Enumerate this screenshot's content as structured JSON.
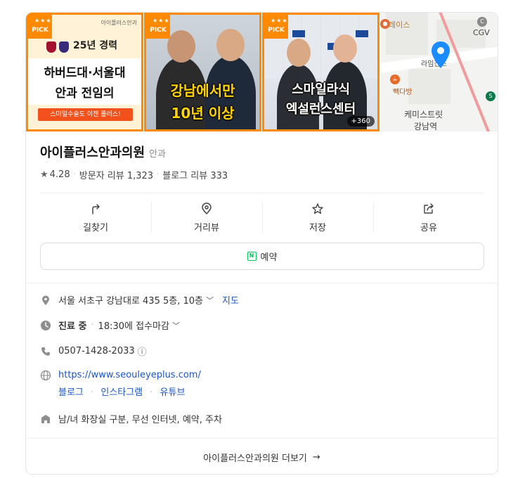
{
  "photos": {
    "pick_label": "PICK",
    "photo1": {
      "logo_text": "아이플러스안과",
      "years": "25년 경력",
      "line1": "하버드대·서울대",
      "line2": "안과 전임의",
      "tagline": "스마일수술도 이젠 플러스!"
    },
    "photo2": {
      "line1": "강남에서만",
      "line2": "10년 이상"
    },
    "photo3": {
      "line1": "스마일라식",
      "line2": "엑설런스센터",
      "more_count": "+360"
    },
    "map": {
      "labels": {
        "top": "레이스",
        "cgv": "CGV",
        "mid": "라임진즈",
        "cafe": "빽다방",
        "station1": "케미스트릿",
        "station2": "강남역"
      }
    }
  },
  "place": {
    "name": "아이플러스안과의원",
    "category": "안과",
    "rating": "4.28",
    "visitor_reviews": "방문자 리뷰 1,323",
    "blog_reviews": "블로그 리뷰 333"
  },
  "actions": [
    {
      "label": "길찾기",
      "icon": "directions-icon"
    },
    {
      "label": "거리뷰",
      "icon": "location-pin-icon"
    },
    {
      "label": "저장",
      "icon": "star-icon"
    },
    {
      "label": "공유",
      "icon": "share-icon"
    }
  ],
  "reserve": {
    "label": "예약",
    "icon_letter": "N"
  },
  "info": {
    "address": "서울 서초구 강남대로 435 5층, 10층",
    "map_link": "지도",
    "status": "진료 중",
    "status_detail": "18:30에 접수마감",
    "phone": "0507-1428-2033",
    "phone_info_glyph": "ⓘ",
    "website": "https://www.seouleyeplus.com/",
    "social": [
      "블로그",
      "인스타그램",
      "유튜브"
    ],
    "amenities": "남/녀 화장실 구분, 무선 인터넷, 예약, 주차"
  },
  "more": {
    "label": "아이플러스안과의원 더보기",
    "arrow": "→"
  },
  "colors": {
    "pick": "#ff8a00",
    "link": "#1a56c4",
    "naver": "#03c75a",
    "pin": "#1a8cff"
  }
}
